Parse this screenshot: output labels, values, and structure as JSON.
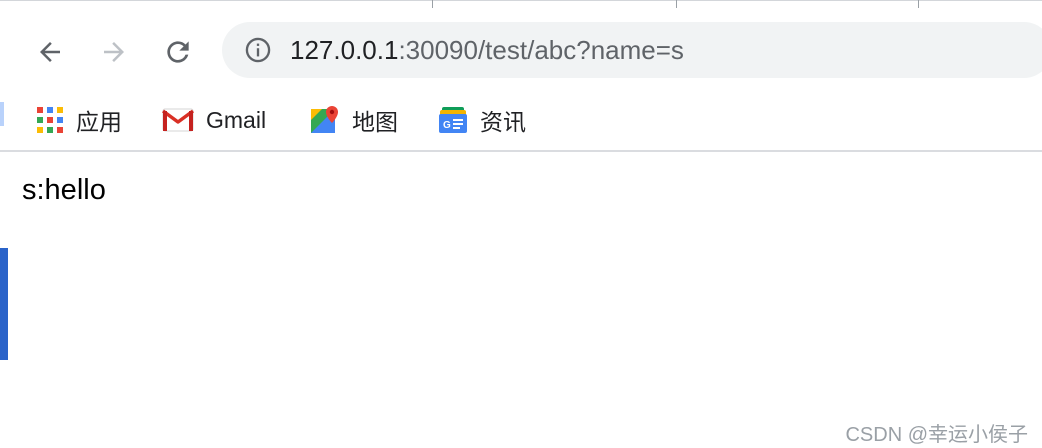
{
  "toolbar": {
    "back_label": "Back",
    "forward_label": "Forward",
    "reload_label": "Reload"
  },
  "omnibox": {
    "host": "127.0.0.1",
    "rest": ":30090/test/abc?name=s"
  },
  "bookmarks": [
    {
      "label": "应用",
      "icon": "apps-grid-icon"
    },
    {
      "label": "Gmail",
      "icon": "gmail-icon"
    },
    {
      "label": "地图",
      "icon": "maps-icon"
    },
    {
      "label": "资讯",
      "icon": "news-icon"
    }
  ],
  "page": {
    "text": "s:hello",
    "watermark": "CSDN @幸运小侯子"
  },
  "colors": {
    "accent_blue": "#2a63c9",
    "omnibox_bg": "#f1f3f4"
  }
}
